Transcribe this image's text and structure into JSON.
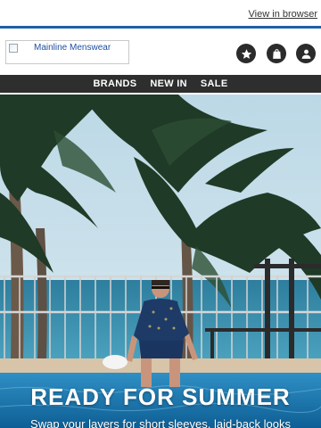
{
  "topbar": {
    "view_in_browser": "View in browser"
  },
  "header": {
    "logo_alt": "Mainline Menswear"
  },
  "icons": [
    "star-icon",
    "bag-icon",
    "user-icon"
  ],
  "nav": {
    "items": [
      "BRANDS",
      "NEW IN",
      "SALE"
    ]
  },
  "hero": {
    "title": "READY FOR SUMMER",
    "subtitle": "Swap your layers for short sleeves, laid-back looks"
  },
  "colors": {
    "accent_line": "#1f5fa8",
    "nav_bg": "#2e2e2e",
    "icon_bg": "#2b2b2b"
  }
}
